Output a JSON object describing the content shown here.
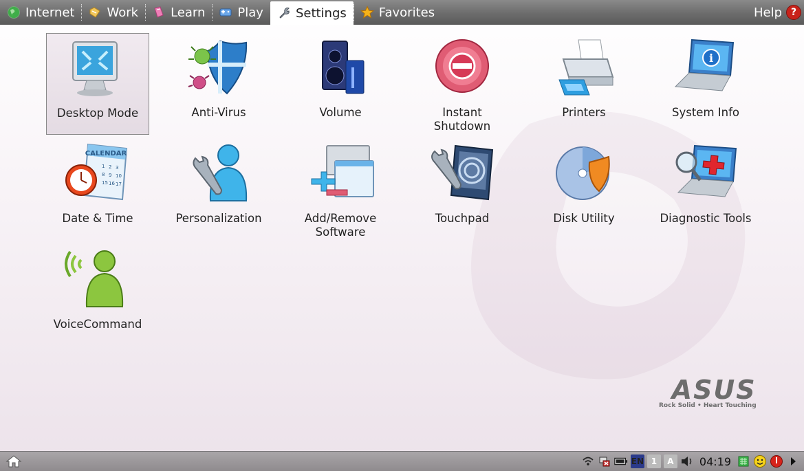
{
  "tabs": [
    {
      "label": "Internet",
      "icon": "globe-icon",
      "active": false
    },
    {
      "label": "Work",
      "icon": "folder-icon",
      "active": false
    },
    {
      "label": "Learn",
      "icon": "book-icon",
      "active": false
    },
    {
      "label": "Play",
      "icon": "gamepad-icon",
      "active": false
    },
    {
      "label": "Settings",
      "icon": "wrench-icon",
      "active": true
    },
    {
      "label": "Favorites",
      "icon": "star-icon",
      "active": false
    }
  ],
  "help": {
    "label": "Help",
    "icon": "question-icon"
  },
  "items": [
    {
      "label": "Desktop Mode",
      "icon": "monitor-icon",
      "selected": true
    },
    {
      "label": "Anti-Virus",
      "icon": "shield-bug-icon",
      "selected": false
    },
    {
      "label": "Volume",
      "icon": "speaker-icon",
      "selected": false
    },
    {
      "label": "Instant\nShutdown",
      "icon": "shutdown-icon",
      "selected": false
    },
    {
      "label": "Printers",
      "icon": "printer-icon",
      "selected": false
    },
    {
      "label": "System Info",
      "icon": "laptop-info-icon",
      "selected": false
    },
    {
      "label": "Date & Time",
      "icon": "calendar-clock-icon",
      "selected": false
    },
    {
      "label": "Personalization",
      "icon": "user-wrench-icon",
      "selected": false
    },
    {
      "label": "Add/Remove\nSoftware",
      "icon": "add-remove-icon",
      "selected": false
    },
    {
      "label": "Touchpad",
      "icon": "touchpad-icon",
      "selected": false
    },
    {
      "label": "Disk Utility",
      "icon": "disk-icon",
      "selected": false
    },
    {
      "label": "Diagnostic Tools",
      "icon": "laptop-magnifier-icon",
      "selected": false
    },
    {
      "label": "VoiceCommand",
      "icon": "voice-user-icon",
      "selected": false
    }
  ],
  "logo": {
    "word": "ASUS",
    "tagline": "Rock Solid • Heart Touching"
  },
  "taskbar": {
    "clock": "04:19",
    "language": "EN",
    "tray_icons": [
      "wireless-icon",
      "network-icon",
      "battery-icon",
      "language-icon",
      "keyboard-1-icon",
      "keyboard-a-icon",
      "volume-icon",
      "clock",
      "memory-icon",
      "smiley-icon",
      "power-icon",
      "arrow-right-icon"
    ],
    "keyboard_1": "1",
    "keyboard_a": "A"
  }
}
